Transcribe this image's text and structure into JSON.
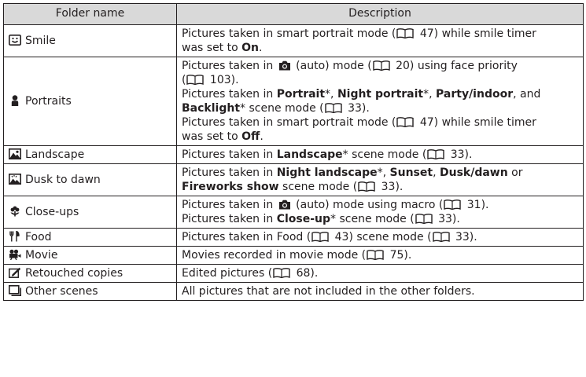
{
  "header": {
    "col1": "Folder name",
    "col2": "Description"
  },
  "rows": [
    {
      "name": "Smile",
      "icon": "smile-icon",
      "lines": [
        [
          "Pictures taken in smart portrait mode (",
          "book",
          " 47) while smile timer"
        ],
        [
          "was set to ",
          "b:On",
          "."
        ]
      ]
    },
    {
      "name": "Portraits",
      "icon": "portrait-icon",
      "lines": [
        [
          "Pictures taken in ",
          "cam",
          " (auto) mode (",
          "book",
          " 20) using face priority"
        ],
        [
          "(",
          "book",
          " 103)."
        ],
        [
          "Pictures taken in ",
          "b:Portrait",
          "*, ",
          "b:Night portrait",
          "*, ",
          "b:Party/indoor",
          ", and"
        ],
        [
          "b:Backlight",
          "* scene mode (",
          "book",
          " 33)."
        ],
        [
          "Pictures taken in smart portrait mode (",
          "book",
          " 47) while smile timer"
        ],
        [
          "was set to ",
          "b:Off",
          "."
        ]
      ]
    },
    {
      "name": "Landscape",
      "icon": "landscape-icon",
      "lines": [
        [
          "Pictures taken in ",
          "b:Landscape",
          "* scene mode (",
          "book",
          " 33)."
        ]
      ]
    },
    {
      "name": "Dusk to dawn",
      "icon": "dusk-to-dawn-icon",
      "lines": [
        [
          "Pictures taken in ",
          "b:Night landscape",
          "*, ",
          "b:Sunset",
          ", ",
          "b:Dusk/dawn",
          " or"
        ],
        [
          "b:Fireworks show",
          " scene mode (",
          "book",
          " 33)."
        ]
      ]
    },
    {
      "name": "Close-ups",
      "icon": "close-up-flower-icon",
      "lines": [
        [
          "Pictures taken in ",
          "cam",
          " (auto) mode using macro (",
          "book",
          " 31)."
        ],
        [
          "Pictures taken in ",
          "b:Close-up",
          "* scene mode (",
          "book",
          " 33)."
        ]
      ]
    },
    {
      "name": "Food",
      "icon": "food-icon",
      "lines": [
        [
          "Pictures taken in Food (",
          "book",
          " 43) scene mode (",
          "book",
          " 33)."
        ]
      ]
    },
    {
      "name": "Movie",
      "icon": "movie-icon",
      "lines": [
        [
          "Movies recorded in movie mode (",
          "book",
          " 75)."
        ]
      ]
    },
    {
      "name": "Retouched copies",
      "icon": "retouch-icon",
      "lines": [
        [
          "Edited pictures (",
          "book",
          " 68)."
        ]
      ]
    },
    {
      "name": "Other scenes",
      "icon": "other-scenes-icon",
      "lines": [
        [
          "All pictures that are not included in the other folders."
        ]
      ]
    }
  ]
}
